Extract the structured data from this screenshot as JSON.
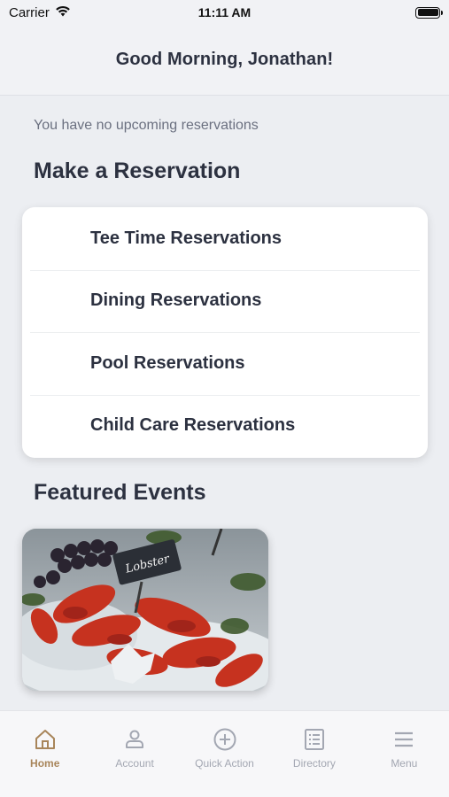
{
  "status_bar": {
    "carrier": "Carrier",
    "time": "11:11 AM",
    "icons": [
      "wifi-icon",
      "battery-icon"
    ]
  },
  "header": {
    "title": "Good Morning, Jonathan!"
  },
  "reservations_notice": "You have no upcoming reservations",
  "make_reservation": {
    "title": "Make a Reservation",
    "items": [
      {
        "label": "Tee Time Reservations"
      },
      {
        "label": "Dining Reservations"
      },
      {
        "label": "Pool Reservations"
      },
      {
        "label": "Child Care Reservations"
      }
    ]
  },
  "featured_events": {
    "title": "Featured Events",
    "image_sign_text": "Lobster"
  },
  "tab_bar": {
    "active_color": "#a8855a",
    "inactive_color": "#a3a7b2",
    "tabs": [
      {
        "label": "Home",
        "icon": "home-icon",
        "active": true
      },
      {
        "label": "Account",
        "icon": "account-icon",
        "active": false
      },
      {
        "label": "Quick Action",
        "icon": "plus-circle-icon",
        "active": false
      },
      {
        "label": "Directory",
        "icon": "directory-icon",
        "active": false
      },
      {
        "label": "Menu",
        "icon": "menu-icon",
        "active": false
      }
    ]
  }
}
